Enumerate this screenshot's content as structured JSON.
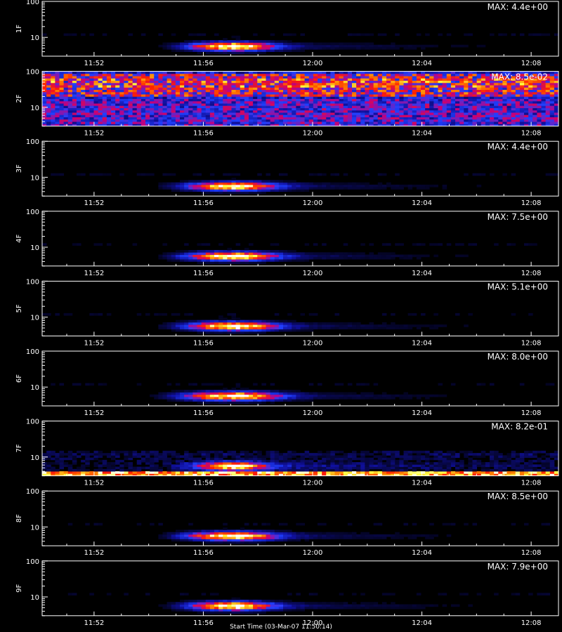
{
  "chart_data": {
    "type": "heatmap",
    "y_scale": "log",
    "ylim": [
      3,
      100
    ],
    "y_ticks": [
      "10",
      "100"
    ],
    "y_tick_values": [
      10,
      100
    ],
    "x_ticks": [
      "11:52",
      "11:56",
      "12:00",
      "12:04",
      "12:08"
    ],
    "x_tick_minutes": [
      712,
      716,
      720,
      724,
      728
    ],
    "xlim_minutes": [
      710.1,
      729.0
    ],
    "colormap": [
      "#000000",
      "#1010a0",
      "#2040ff",
      "#c00080",
      "#ff2000",
      "#ff8000",
      "#ffff40",
      "#ffffff"
    ],
    "panels": [
      {
        "label": "1F",
        "max_text": "MAX: 4.4e+00",
        "pattern": "burst",
        "burst_center": 717.0,
        "burst_width": 1.5,
        "peak": 1.0
      },
      {
        "label": "2F",
        "max_text": "MAX: 8.5e-02",
        "pattern": "noise",
        "peak": 1.0
      },
      {
        "label": "3F",
        "max_text": "MAX: 4.4e+00",
        "pattern": "burst",
        "burst_center": 717.0,
        "burst_width": 1.6,
        "peak": 0.95
      },
      {
        "label": "4F",
        "max_text": "MAX: 7.5e+00",
        "pattern": "burst",
        "burst_center": 717.0,
        "burst_width": 1.6,
        "peak": 1.0
      },
      {
        "label": "5F",
        "max_text": "MAX: 5.1e+00",
        "pattern": "burst",
        "burst_center": 717.0,
        "burst_width": 1.6,
        "peak": 1.0
      },
      {
        "label": "6F",
        "max_text": "MAX: 8.0e+00",
        "pattern": "burst",
        "burst_center": 717.0,
        "burst_width": 1.7,
        "peak": 1.0
      },
      {
        "label": "7F",
        "max_text": "MAX: 8.2e-01",
        "pattern": "burst_band",
        "burst_center": 717.0,
        "burst_width": 1.3,
        "peak": 0.9
      },
      {
        "label": "8F",
        "max_text": "MAX: 8.5e+00",
        "pattern": "burst",
        "burst_center": 717.0,
        "burst_width": 1.6,
        "peak": 1.0
      },
      {
        "label": "9F",
        "max_text": "MAX: 7.9e+00",
        "pattern": "burst",
        "burst_center": 717.0,
        "burst_width": 1.5,
        "peak": 1.0
      }
    ]
  },
  "footer": {
    "text": "Start Time (03-Mar-07 11:50:14)"
  }
}
